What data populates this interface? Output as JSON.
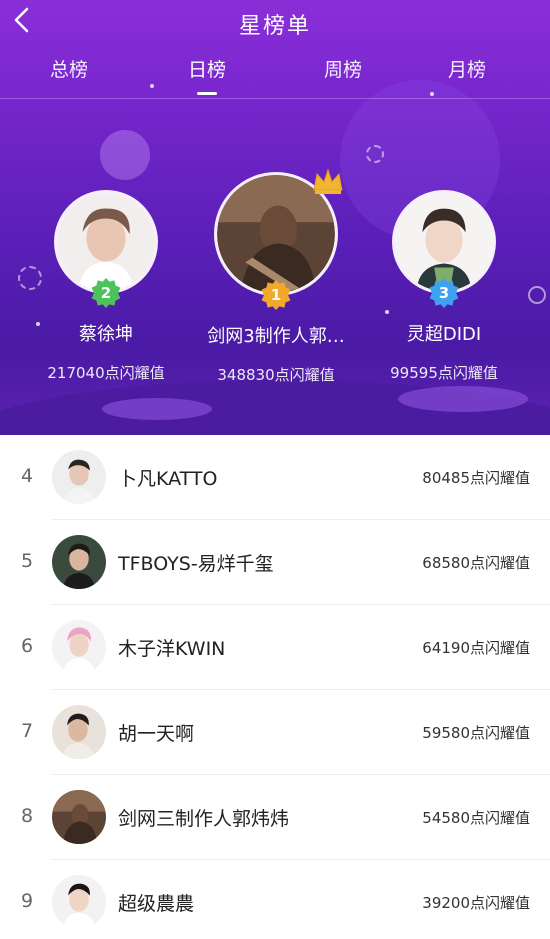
{
  "header": {
    "title": "星榜单",
    "back_icon": "chevron-left-icon"
  },
  "tabs": [
    {
      "label": "总榜",
      "active": false
    },
    {
      "label": "日榜",
      "active": true
    },
    {
      "label": "周榜",
      "active": false
    },
    {
      "label": "月榜",
      "active": false
    }
  ],
  "podium": {
    "second": {
      "rank": "2",
      "name": "蔡徐坤",
      "score": "217040点闪耀值",
      "badge_color": "#4cc35a"
    },
    "first": {
      "rank": "1",
      "name": "剑网3制作人郭…",
      "score": "348830点闪耀值",
      "badge_color": "#f2a92b"
    },
    "third": {
      "rank": "3",
      "name": "灵超DIDI",
      "score": "99595点闪耀值",
      "badge_color": "#3ea2f0"
    }
  },
  "ranking": [
    {
      "rank": "4",
      "name": "卜凡KATTO",
      "score": "80485点闪耀值"
    },
    {
      "rank": "5",
      "name": "TFBOYS-易烊千玺",
      "score": "68580点闪耀值"
    },
    {
      "rank": "6",
      "name": "木子洋KWIN",
      "score": "64190点闪耀值"
    },
    {
      "rank": "7",
      "name": "胡一天啊",
      "score": "59580点闪耀值"
    },
    {
      "rank": "8",
      "name": "剑网三制作人郭炜炜",
      "score": "54580点闪耀值"
    },
    {
      "rank": "9",
      "name": "超级農農",
      "score": "39200点闪耀值"
    }
  ],
  "colors": {
    "header_purple": "#7a27cf",
    "gold_crown": "#f2b533"
  }
}
